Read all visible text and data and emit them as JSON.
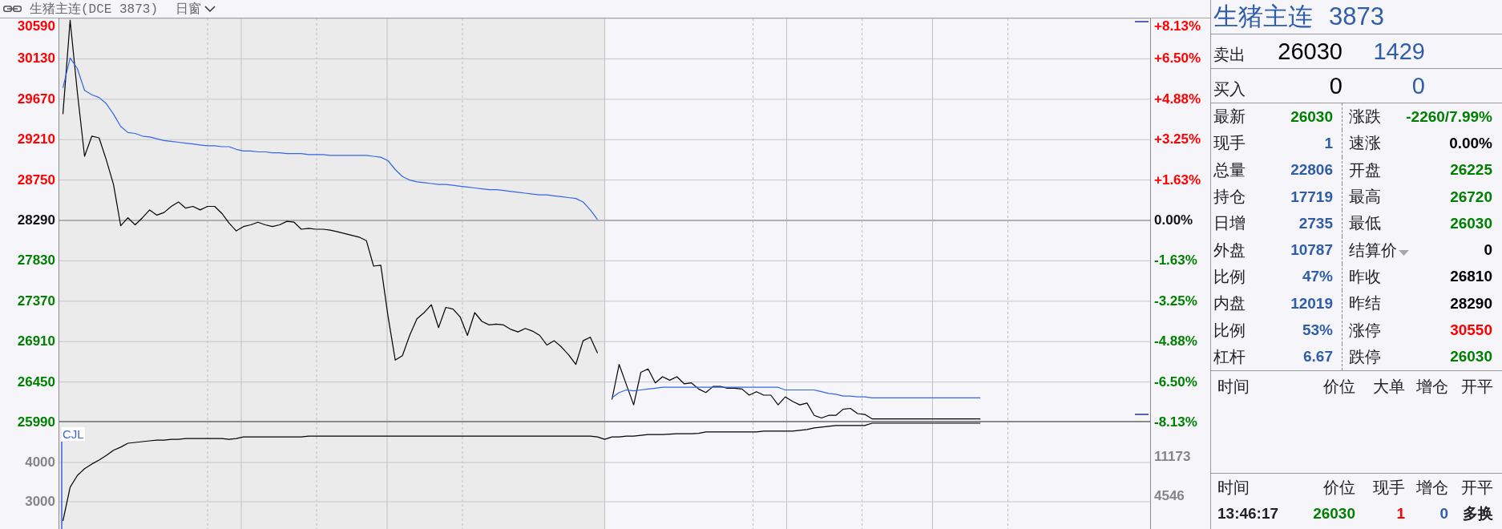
{
  "toolbar": {
    "symbol": "生猪主连(DCE 3873)",
    "period": "日窗"
  },
  "price_chart": {
    "chart_data": {
      "type": "line",
      "grid": true,
      "ylim": [
        25990,
        30590
      ],
      "yticks": [
        30590,
        30130,
        29670,
        29210,
        28750,
        28290,
        27830,
        27370,
        26910,
        26450,
        25990
      ],
      "ref_lines": [
        {
          "axis": "y",
          "value": 28290
        }
      ],
      "series": [
        {
          "color": "#000000",
          "values": [
            29500,
            30570,
            29750,
            29020,
            29250,
            29230,
            28980,
            28700,
            28230,
            28320,
            28240,
            28320,
            28410,
            28350,
            28380,
            28450,
            28500,
            28430,
            28450,
            28410,
            28450,
            28450,
            28370,
            28260,
            28170,
            28220,
            28240,
            28270,
            28240,
            28220,
            28240,
            28280,
            28270,
            28190,
            28200,
            28190,
            28190,
            28180,
            28160,
            28140,
            28120,
            28100,
            28060,
            27770,
            27780,
            27200,
            26700,
            26750,
            26980,
            27170,
            27240,
            27330,
            27070,
            27300,
            27280,
            27190,
            26980,
            27240,
            27140,
            27100,
            27110,
            27100,
            27050,
            27020,
            27060,
            27030,
            26980,
            26870,
            26920,
            26850,
            26760,
            26650,
            26920,
            26960,
            26780,
            null,
            26250,
            26650,
            26420,
            26190,
            26560,
            26600,
            26440,
            26510,
            26470,
            26510,
            26430,
            26440,
            26370,
            26330,
            26400,
            26400,
            26380,
            26380,
            26370,
            26300,
            26340,
            26300,
            26300,
            26190,
            26280,
            26230,
            26190,
            26210,
            26070,
            26040,
            26070,
            26070,
            26140,
            26150,
            26090,
            26080,
            26030,
            26030,
            26030,
            26030,
            26030,
            26030,
            26030,
            26030,
            26030,
            26030,
            26030,
            26030,
            26030,
            26030,
            26030,
            26030,
            null,
            null,
            null,
            null,
            null,
            null,
            null,
            null,
            null,
            null,
            null,
            null,
            null,
            null,
            null,
            null,
            null,
            null,
            null,
            null,
            null,
            null,
            null
          ]
        },
        {
          "color": "#3366e6",
          "values": [
            29800,
            30140,
            30020,
            29770,
            29720,
            29690,
            29620,
            29500,
            29360,
            29290,
            29280,
            29250,
            29240,
            29220,
            29200,
            29190,
            29180,
            29170,
            29160,
            29150,
            29140,
            29140,
            29130,
            29130,
            29100,
            29080,
            29080,
            29070,
            29070,
            29060,
            29060,
            29050,
            29050,
            29050,
            29040,
            29040,
            29040,
            29030,
            29030,
            29030,
            29030,
            29030,
            29030,
            29020,
            29010,
            28970,
            28870,
            28790,
            28750,
            28730,
            28720,
            28710,
            28700,
            28700,
            28690,
            28680,
            28670,
            28660,
            28650,
            28640,
            28640,
            28630,
            28620,
            28610,
            28600,
            28590,
            28580,
            28580,
            28570,
            28560,
            28550,
            28540,
            28500,
            28410,
            28300,
            null,
            26270,
            26330,
            26360,
            26350,
            26360,
            26370,
            26380,
            26390,
            26390,
            26390,
            26390,
            26390,
            26390,
            26390,
            26390,
            26390,
            26390,
            26390,
            26390,
            26390,
            26390,
            26390,
            26390,
            26390,
            26360,
            26360,
            26360,
            26360,
            26360,
            26340,
            26320,
            26310,
            26290,
            26290,
            26280,
            26280,
            26270,
            26270,
            26270,
            26270,
            26270,
            26270,
            26270,
            26270,
            26270,
            26270,
            26270,
            26270,
            26270,
            26270,
            26270,
            26270,
            null,
            null,
            null,
            null,
            null,
            null,
            null,
            null,
            null,
            null,
            null,
            null,
            null,
            null,
            null,
            null,
            null,
            null,
            null,
            null,
            null,
            null,
            null
          ]
        }
      ]
    },
    "right_axis_labels": [
      "+8.13%",
      "+6.50%",
      "+4.88%",
      "+3.25%",
      "+1.63%",
      "0.00%",
      "-1.63%",
      "-3.25%",
      "-4.88%",
      "-6.50%",
      "-8.13%"
    ]
  },
  "volume_chart": {
    "chart_data": {
      "type": "line",
      "grid": true,
      "title": "CJL",
      "ylim": [
        2306,
        5020
      ],
      "yticks": [
        4000,
        3000
      ],
      "series": [
        {
          "color": "#000000",
          "values": [
            2510,
            3370,
            3670,
            3840,
            3960,
            4060,
            4180,
            4310,
            4390,
            4490,
            4510,
            4530,
            4550,
            4570,
            4570,
            4590,
            4590,
            4610,
            4610,
            4610,
            4610,
            4610,
            4610,
            4590,
            4610,
            4650,
            4650,
            4650,
            4650,
            4650,
            4650,
            4650,
            4650,
            4650,
            4670,
            4670,
            4670,
            4670,
            4670,
            4670,
            4670,
            4670,
            4670,
            4670,
            4670,
            4670,
            4670,
            4670,
            4670,
            4670,
            4670,
            4670,
            4670,
            4670,
            4670,
            4670,
            4670,
            4670,
            4670,
            4670,
            4670,
            4670,
            4670,
            4670,
            4670,
            4670,
            4670,
            4670,
            4670,
            4670,
            4670,
            4670,
            4670,
            4670,
            4650,
            4590,
            4650,
            4650,
            4670,
            4670,
            4690,
            4710,
            4710,
            4710,
            4720,
            4730,
            4730,
            4730,
            4740,
            4780,
            4780,
            4780,
            4780,
            4780,
            4780,
            4780,
            4780,
            4800,
            4800,
            4800,
            4800,
            4800,
            4820,
            4840,
            4880,
            4900,
            4920,
            4940,
            4940,
            4940,
            4940,
            4940,
            5000,
            5000,
            5000,
            5000,
            5000,
            5000,
            5000,
            5000,
            5000,
            5000,
            5000,
            5000,
            5000,
            5000,
            5000,
            5000,
            null,
            null,
            null,
            null,
            null,
            null,
            null,
            null,
            null,
            null,
            null,
            null,
            null,
            null,
            null,
            null,
            null,
            null,
            null,
            null,
            null,
            null,
            null
          ]
        }
      ]
    },
    "right_axis_labels": [
      "11173",
      "4546"
    ]
  },
  "quote": {
    "name": "生猪主连",
    "code": "3873",
    "ask": {
      "label": "卖出",
      "price": "26030",
      "volume": "1429"
    },
    "bid": {
      "label": "买入",
      "price": "0",
      "volume": "0"
    },
    "stats": [
      {
        "left": {
          "label": "最新",
          "value": "26030",
          "color": "#008000",
          "dropdown": false
        },
        "right": {
          "label": "涨跌",
          "value": "-2260/7.99%",
          "color": "#008000",
          "dropdown": false
        }
      },
      {
        "left": {
          "label": "现手",
          "value": "1",
          "color": "#2f5da8",
          "dropdown": false
        },
        "right": {
          "label": "速涨",
          "value": "0.00%",
          "color": "#000000",
          "dropdown": false
        }
      },
      {
        "left": {
          "label": "总量",
          "value": "22806",
          "color": "#2f5da8",
          "dropdown": false
        },
        "right": {
          "label": "开盘",
          "value": "26225",
          "color": "#008000",
          "dropdown": false
        }
      },
      {
        "left": {
          "label": "持仓",
          "value": "17719",
          "color": "#2f5da8",
          "dropdown": false
        },
        "right": {
          "label": "最高",
          "value": "26720",
          "color": "#008000",
          "dropdown": false
        }
      },
      {
        "left": {
          "label": "日增",
          "value": "2735",
          "color": "#2f5da8",
          "dropdown": false
        },
        "right": {
          "label": "最低",
          "value": "26030",
          "color": "#008000",
          "dropdown": false
        }
      },
      {
        "left": {
          "label": "外盘",
          "value": "10787",
          "color": "#2f5da8",
          "dropdown": false
        },
        "right": {
          "label": "结算价",
          "value": "0",
          "color": "#000000",
          "dropdown": true
        }
      },
      {
        "left": {
          "label": "比例",
          "value": "47%",
          "color": "#2f5da8",
          "dropdown": false
        },
        "right": {
          "label": "昨收",
          "value": "26810",
          "color": "#000000",
          "dropdown": false
        }
      },
      {
        "left": {
          "label": "内盘",
          "value": "12019",
          "color": "#2f5da8",
          "dropdown": false
        },
        "right": {
          "label": "昨结",
          "value": "28290",
          "color": "#000000",
          "dropdown": false
        }
      },
      {
        "left": {
          "label": "比例",
          "value": "53%",
          "color": "#2f5da8",
          "dropdown": false
        },
        "right": {
          "label": "涨停",
          "value": "30550",
          "color": "#ff0000",
          "dropdown": false
        }
      },
      {
        "left": {
          "label": "杠杆",
          "value": "6.67",
          "color": "#2f5da8",
          "dropdown": false
        },
        "right": {
          "label": "跌停",
          "value": "26030",
          "color": "#008000",
          "dropdown": false
        }
      }
    ],
    "big_orders": {
      "columns": [
        "时间",
        "价位",
        "大单",
        "增仓",
        "开平"
      ]
    },
    "ticks": {
      "columns": [
        "时间",
        "价位",
        "现手",
        "增仓",
        "开平"
      ],
      "rows": [
        {
          "cells": [
            {
              "text": "13:46:17",
              "color": "#222222"
            },
            {
              "text": "26030",
              "color": "#008000"
            },
            {
              "text": "1",
              "color": "#ff0000"
            },
            {
              "text": "0",
              "color": "#2f5da8"
            },
            {
              "text": "多换",
              "color": "#222222"
            }
          ]
        }
      ]
    }
  }
}
